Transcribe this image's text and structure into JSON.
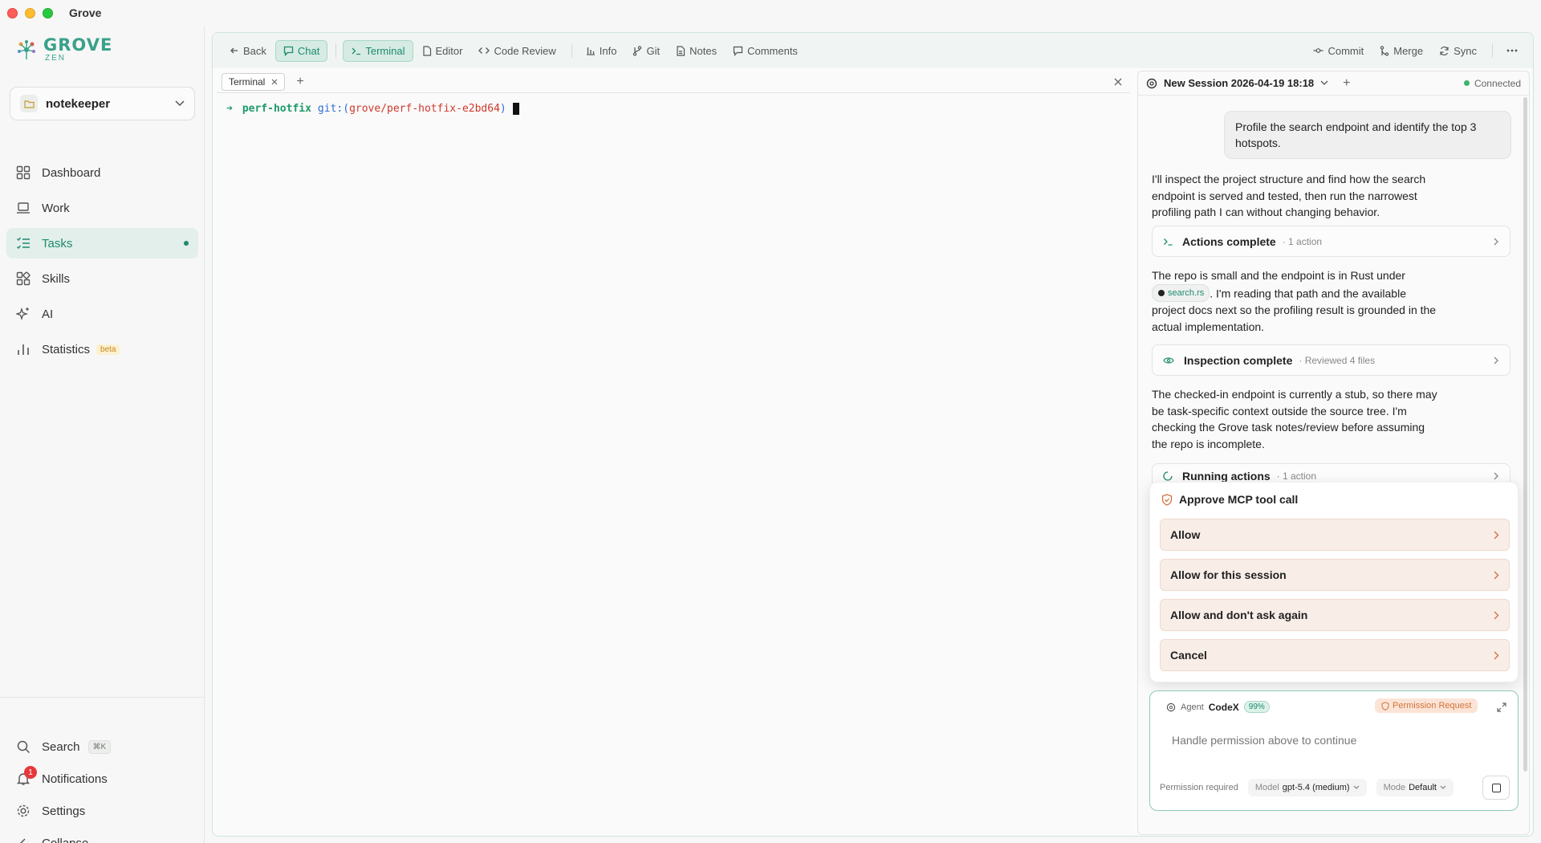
{
  "window": {
    "title": "Grove"
  },
  "logo": {
    "name": "GROVE",
    "sub": "ZEN"
  },
  "project": {
    "name": "notekeeper"
  },
  "nav": [
    {
      "label": "Dashboard",
      "icon": "grid-icon"
    },
    {
      "label": "Work",
      "icon": "laptop-icon"
    },
    {
      "label": "Tasks",
      "icon": "tasks-icon",
      "active": true
    },
    {
      "label": "Skills",
      "icon": "blocks-icon"
    },
    {
      "label": "AI",
      "icon": "sparkle-icon"
    },
    {
      "label": "Statistics",
      "icon": "bar-chart-icon",
      "badge": "beta"
    }
  ],
  "bottom_nav": {
    "search": {
      "label": "Search",
      "shortcut": "⌘K"
    },
    "notifications": {
      "label": "Notifications",
      "count": "1"
    },
    "settings": {
      "label": "Settings"
    },
    "collapse": {
      "label": "Collapse"
    }
  },
  "toolbar": {
    "back": "Back",
    "chat": "Chat",
    "terminal": "Terminal",
    "editor": "Editor",
    "code_review": "Code Review",
    "info": "Info",
    "git": "Git",
    "notes": "Notes",
    "comments": "Comments",
    "commit": "Commit",
    "merge": "Merge",
    "sync": "Sync"
  },
  "terminal": {
    "tab_label": "Terminal",
    "prompt_arrow": "➜",
    "dir": "perf-hotfix",
    "git_prefix": "git:(",
    "branch": "grove/perf-hotfix-e2bd64",
    "git_suffix": ")"
  },
  "chat": {
    "session_title": "New Session 2026-04-19 18:18",
    "status": "Connected",
    "user_message": "Profile the search endpoint and identify the top 3 hotspots.",
    "msg1": "I'll inspect the project structure and find how the search endpoint is served and tested, then run the narrowest profiling path I can without changing behavior.",
    "card1": {
      "title": "Actions complete",
      "sub": "· 1 action"
    },
    "msg2_a": "The repo is small and the endpoint is in Rust under",
    "msg2_chip": "search.rs",
    "msg2_b": ". I'm reading that path and the available project docs next so the profiling result is grounded in the actual implementation.",
    "card2": {
      "title": "Inspection complete",
      "sub": "· Reviewed 4 files"
    },
    "msg3": "The checked-in endpoint is currently a stub, so there may be task-specific context outside the source tree. I'm checking the Grove task notes/review before assuming the repo is incomplete.",
    "card3": {
      "title": "Running actions",
      "sub": "· 1 action"
    }
  },
  "permission": {
    "title": "Approve MCP tool call",
    "options": [
      "Allow",
      "Allow for this session",
      "Allow and don't ask again",
      "Cancel"
    ]
  },
  "composer": {
    "agent_label": "Agent",
    "agent_name": "CodeX",
    "context_pct": "99%",
    "permission_badge": "Permission Request",
    "placeholder": "Handle permission above to continue",
    "status": "Permission required",
    "model_label": "Model",
    "model_value": "gpt-5.4 (medium)",
    "mode_label": "Mode",
    "mode_value": "Default"
  },
  "colors": {
    "accent": "#1e8a6f",
    "warning": "#d0743c",
    "danger": "#e5383b"
  }
}
